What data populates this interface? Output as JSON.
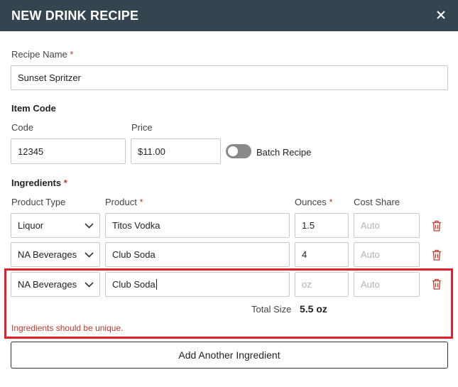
{
  "dialog": {
    "title": "NEW DRINK RECIPE"
  },
  "recipe_name": {
    "label": "Recipe Name",
    "required_mark": "*",
    "value": "Sunset Spritzer"
  },
  "item_code": {
    "heading": "Item Code",
    "code_label": "Code",
    "code_value": "12345",
    "price_label": "Price",
    "price_value": "$11.00",
    "batch_label": "Batch Recipe",
    "batch_enabled": false
  },
  "ingredients": {
    "heading": "Ingredients",
    "required_mark": "*",
    "columns": {
      "product_type": "Product Type",
      "product": "Product",
      "ounces": "Ounces",
      "cost_share": "Cost Share"
    },
    "rows": [
      {
        "product_type": "Liquor",
        "product": "Titos Vodka",
        "ounces": "1.5",
        "ounces_placeholder": "oz",
        "cost_share_placeholder": "Auto"
      },
      {
        "product_type": "NA Beverages",
        "product": "Club Soda",
        "ounces": "4",
        "ounces_placeholder": "oz",
        "cost_share_placeholder": "Auto"
      },
      {
        "product_type": "NA Beverages",
        "product": "Club Soda",
        "ounces": "",
        "ounces_placeholder": "oz",
        "cost_share_placeholder": "Auto"
      }
    ],
    "total_size_label": "Total Size",
    "total_size_value": "5.5 oz",
    "error": "Ingredients should be unique.",
    "add_button": "Add Another Ingredient"
  },
  "colors": {
    "header_bg": "#35454f",
    "required": "#c0392b",
    "error_outline": "#e0202c",
    "trash_icon": "#c0392b"
  },
  "icons": [
    "close-icon",
    "chevron-down-icon",
    "trash-icon"
  ]
}
